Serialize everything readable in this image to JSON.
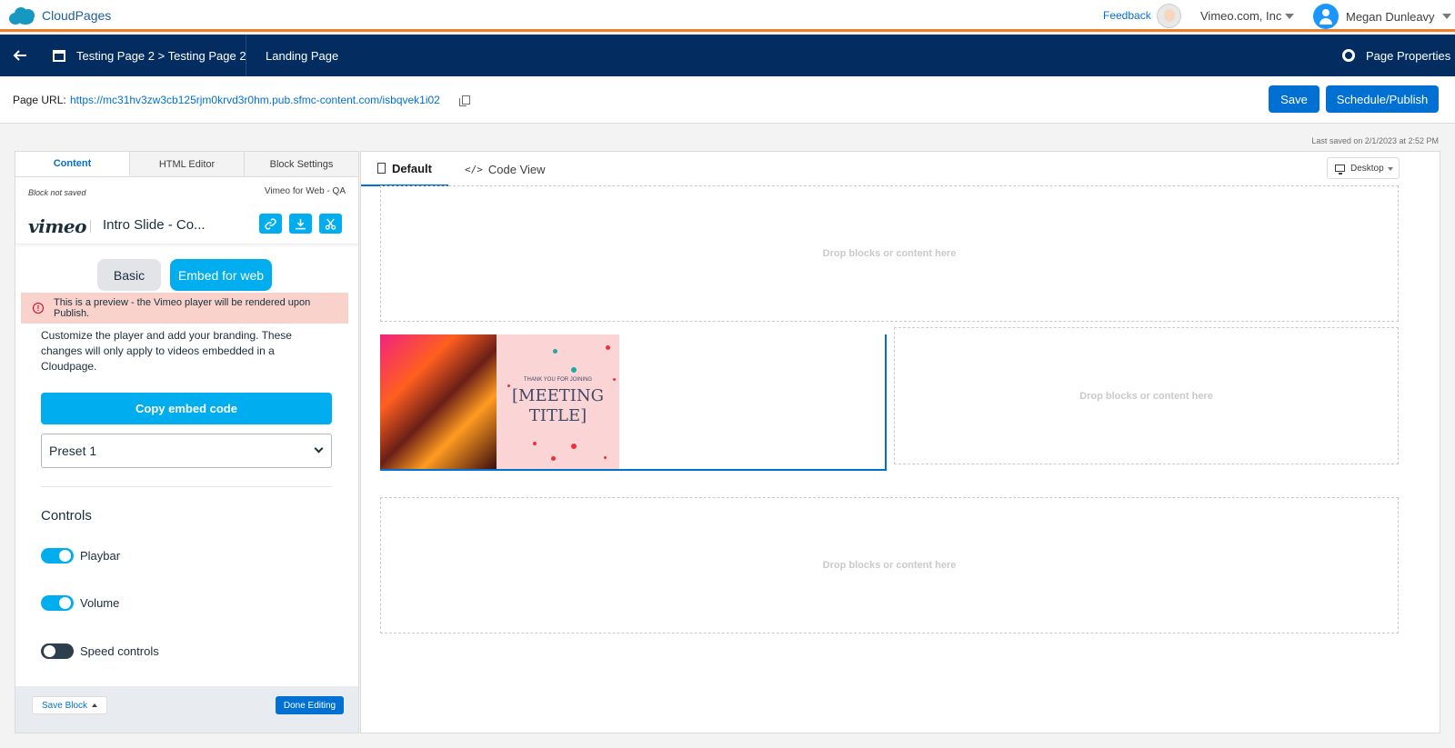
{
  "app": {
    "name": "CloudPages"
  },
  "topbar": {
    "feedback": "Feedback",
    "org": "Vimeo.com, Inc",
    "user": "Megan Dunleavy"
  },
  "nav": {
    "breadcrumb": "Testing Page 2 > Testing Page 2",
    "page_type": "Landing Page",
    "properties": "Page Properties"
  },
  "urlbar": {
    "label": "Page URL:",
    "url": "https://mc31hv3zw3cb125rjm0krvd3r0hm.pub.sfmc-content.com/isbqvek1i02",
    "save": "Save",
    "publish": "Schedule/Publish"
  },
  "last_saved": "Last saved on 2/1/2023 at 2:52 PM",
  "left_panel": {
    "tabs": [
      "Content",
      "HTML Editor",
      "Block Settings"
    ],
    "block_status": "Block not saved",
    "block_source": "Vimeo for Web - QA",
    "vimeo_logo": "vimeo",
    "video_title": "Intro Slide - Co...",
    "segments": {
      "basic": "Basic",
      "embed": "Embed for web"
    },
    "alert": "This is a preview - the Vimeo player will be rendered upon Publish.",
    "description": "Customize the player and add your branding. These changes will only apply to videos embedded in a Cloudpage.",
    "copy_embed": "Copy embed code",
    "preset": "Preset 1",
    "controls_heading": "Controls",
    "toggles": [
      {
        "label": "Playbar",
        "on": true
      },
      {
        "label": "Volume",
        "on": true
      },
      {
        "label": "Speed controls",
        "on": false
      }
    ],
    "save_block": "Save Block",
    "done_editing": "Done Editing"
  },
  "canvas": {
    "tabs": [
      "Default",
      "Code View"
    ],
    "device": "Desktop",
    "drop_text": "Drop blocks or content here",
    "thumbnail": {
      "small": "THANK YOU FOR JOINING",
      "title": "[MEETING TITLE]"
    }
  }
}
